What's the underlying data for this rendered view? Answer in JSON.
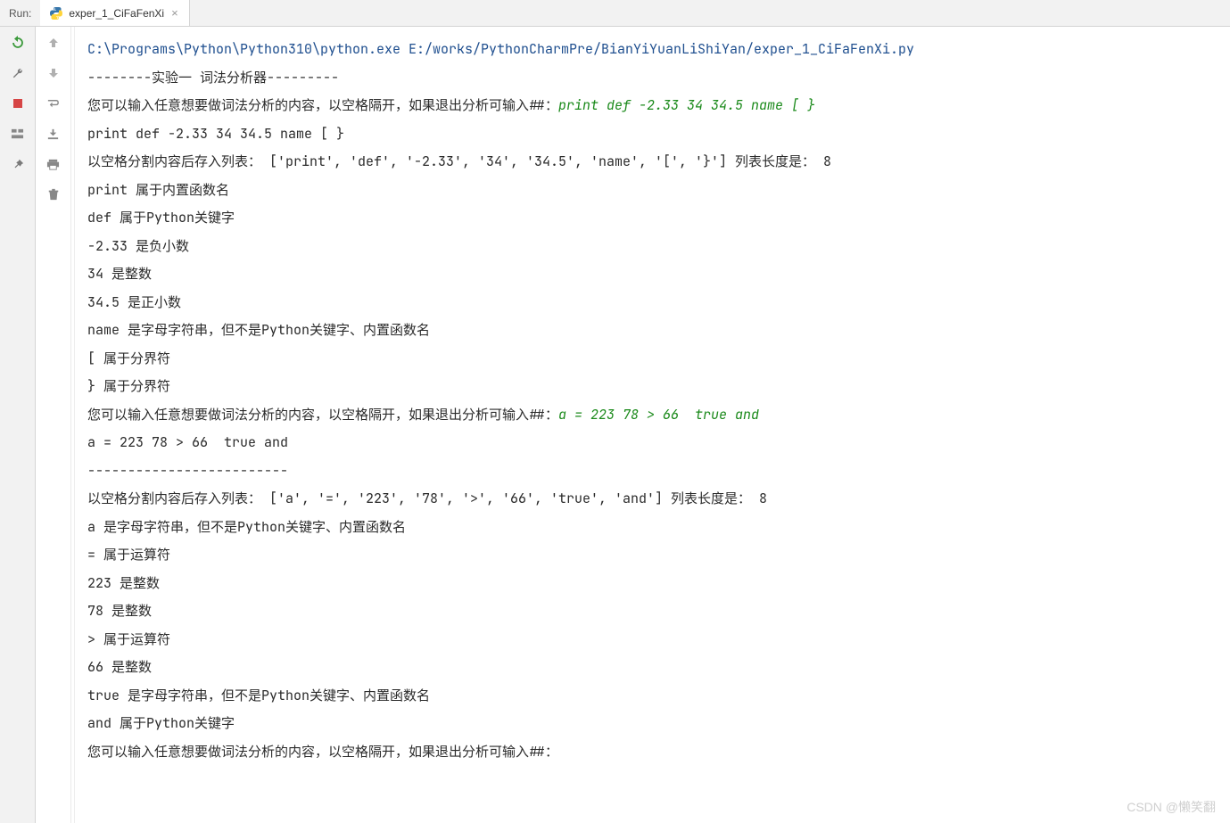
{
  "header": {
    "run_label": "Run:",
    "tab": {
      "name": "exper_1_CiFaFenXi",
      "close": "×"
    }
  },
  "console": {
    "path_line": "C:\\Programs\\Python\\Python310\\python.exe E:/works/PythonCharmPre/BianYiYuanLiShiYan/exper_1_CiFaFenXi.py",
    "header_line": "--------实验一 词法分析器---------",
    "prompt1_prefix": "您可以输入任意想要做词法分析的内容，以空格隔开，如果退出分析可输入##：",
    "prompt1_input": "print def -2.33 34 34.5 name [ }",
    "echo1": "print def -2.33 34 34.5 name [ }",
    "list1": "以空格分割内容后存入列表： ['print', 'def', '-2.33', '34', '34.5', 'name', '[', '}'] 列表长度是： 8",
    "r1_1": "print 属于内置函数名",
    "r1_2": "def 属于Python关键字",
    "r1_3": "-2.33 是负小数",
    "r1_4": "34 是整数",
    "r1_5": "34.5 是正小数",
    "r1_6": "name 是字母字符串，但不是Python关键字、内置函数名",
    "r1_7": "[ 属于分界符",
    "r1_8": "} 属于分界符",
    "prompt2_prefix": "您可以输入任意想要做词法分析的内容，以空格隔开，如果退出分析可输入##：",
    "prompt2_input": "a = 223 78 > 66  true and",
    "echo2": "a = 223 78 > 66  true and",
    "dash2": "-------------------------",
    "list2": "以空格分割内容后存入列表： ['a', '=', '223', '78', '>', '66', 'true', 'and'] 列表长度是： 8",
    "r2_1": "a 是字母字符串，但不是Python关键字、内置函数名",
    "r2_2": "= 属于运算符",
    "r2_3": "223 是整数",
    "r2_4": "78 是整数",
    "r2_5": "> 属于运算符",
    "r2_6": "66 是整数",
    "r2_7": "true 是字母字符串，但不是Python关键字、内置函数名",
    "r2_8": "and 属于Python关键字",
    "prompt3": "您可以输入任意想要做词法分析的内容，以空格隔开，如果退出分析可输入##："
  },
  "watermark": "CSDN @懒笑翻"
}
